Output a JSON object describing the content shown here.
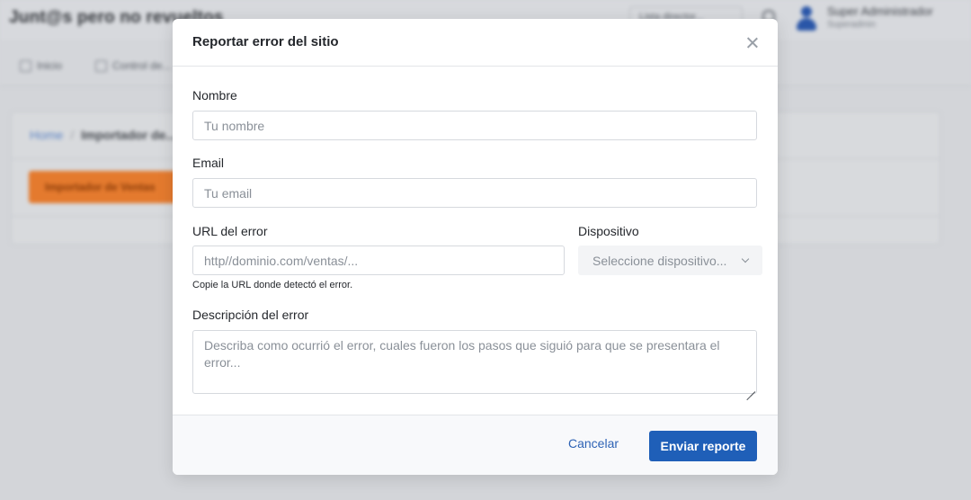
{
  "background": {
    "brand": "Junt@s pero no revueltos",
    "topbar_select": "Lista director...",
    "user_name": "Super Administrador",
    "user_role": "Superadmin",
    "nav": [
      "Inicio",
      "Control de..."
    ],
    "breadcrumb": {
      "home": "Home",
      "separator": "/",
      "current": "Importador de..."
    },
    "primary_action": "Importador de Ventas"
  },
  "modal": {
    "title": "Reportar error del sitio",
    "name": {
      "label": "Nombre",
      "placeholder": "Tu nombre",
      "value": ""
    },
    "email": {
      "label": "Email",
      "placeholder": "Tu email",
      "value": ""
    },
    "url": {
      "label": "URL del error",
      "placeholder": "http//dominio.com/ventas/...",
      "help": "Copie la URL donde detectó el error.",
      "value": ""
    },
    "device": {
      "label": "Dispositivo",
      "selected": "Seleccione dispositivo..."
    },
    "description": {
      "label": "Descripción del error",
      "placeholder": "Describa como ocurrió el error, cuales fueron los pasos que siguió para que se presentara el error..."
    },
    "cancel_label": "Cancelar",
    "submit_label": "Enviar reporte"
  },
  "colors": {
    "primary": "#1f5fb8",
    "accent_orange": "#e47a2e",
    "overlay": "#d3d5d9"
  }
}
